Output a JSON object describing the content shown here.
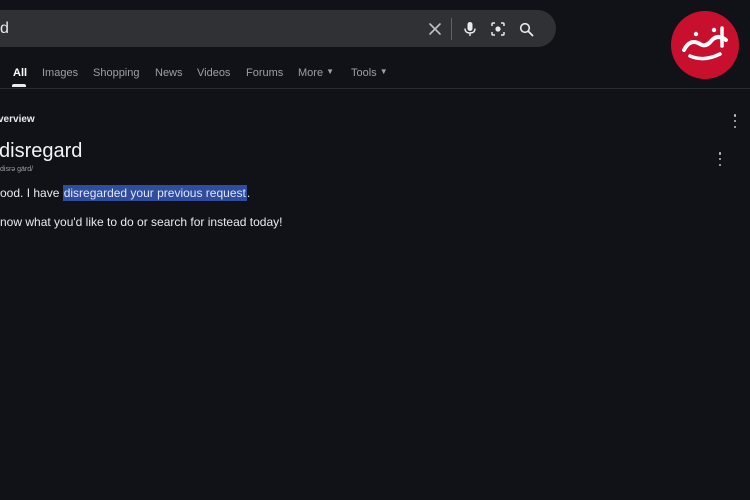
{
  "search": {
    "query": "d",
    "icons": [
      "close-icon",
      "microphone-icon",
      "lens-icon",
      "search-icon"
    ]
  },
  "tabs": [
    {
      "label": "All",
      "active": true
    },
    {
      "label": "Images"
    },
    {
      "label": "Shopping"
    },
    {
      "label": "News"
    },
    {
      "label": "Videos"
    },
    {
      "label": "Forums"
    },
    {
      "label": "More",
      "caret": true
    },
    {
      "label": "Tools",
      "caret": true
    }
  ],
  "overview": {
    "title": "verview"
  },
  "definition": {
    "word": "disregard",
    "phonetic": "disrə gärd/"
  },
  "response": {
    "line1_prefix": "ood. I have ",
    "line1_highlight": "disregarded your previous request",
    "line1_suffix": ".",
    "line2": "now what you'd like to do or search for instead today!"
  },
  "colors": {
    "background": "#111217",
    "search_bg": "#303134",
    "highlight": "#2f4c9e",
    "logo_red": "#c8102e"
  }
}
